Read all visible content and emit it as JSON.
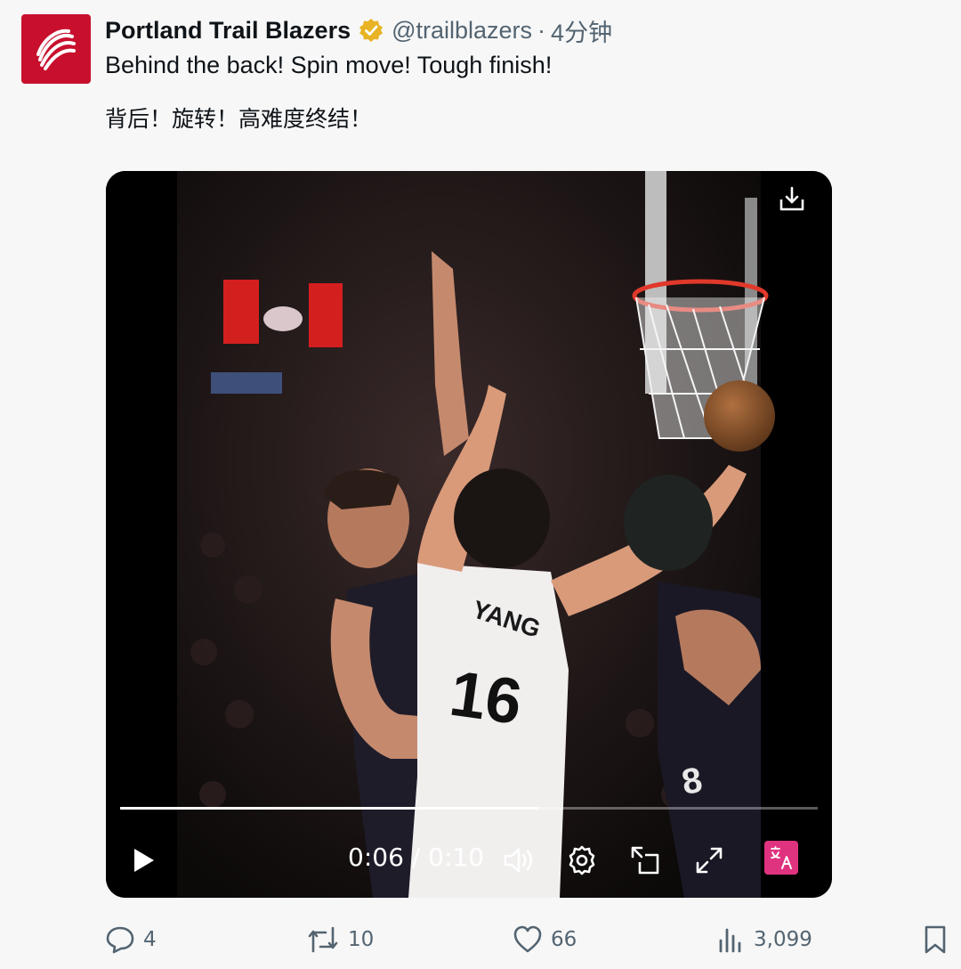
{
  "author": {
    "name": "Portland Trail Blazers",
    "handle": "@trailblazers",
    "separator": "·",
    "time": "4分钟",
    "verified_color": "#e8b324",
    "avatar_color": "#c8102e"
  },
  "post": {
    "text_en": "Behind the back! Spin move! Tough finish!",
    "text_zh": "背后！旋转！高难度终结！"
  },
  "video": {
    "current_time": "0:06",
    "duration": "0:10",
    "time_separator": " / ",
    "progress": 0.6,
    "jersey_name": "YANG",
    "jersey_number": "16",
    "opponent_number": "8",
    "icons": [
      "download-icon",
      "play-icon",
      "volume-icon",
      "settings-icon",
      "pip-icon",
      "fullscreen-icon",
      "translate-icon"
    ]
  },
  "actions": {
    "replies": "4",
    "reposts": "10",
    "likes": "66",
    "views": "3,099"
  }
}
